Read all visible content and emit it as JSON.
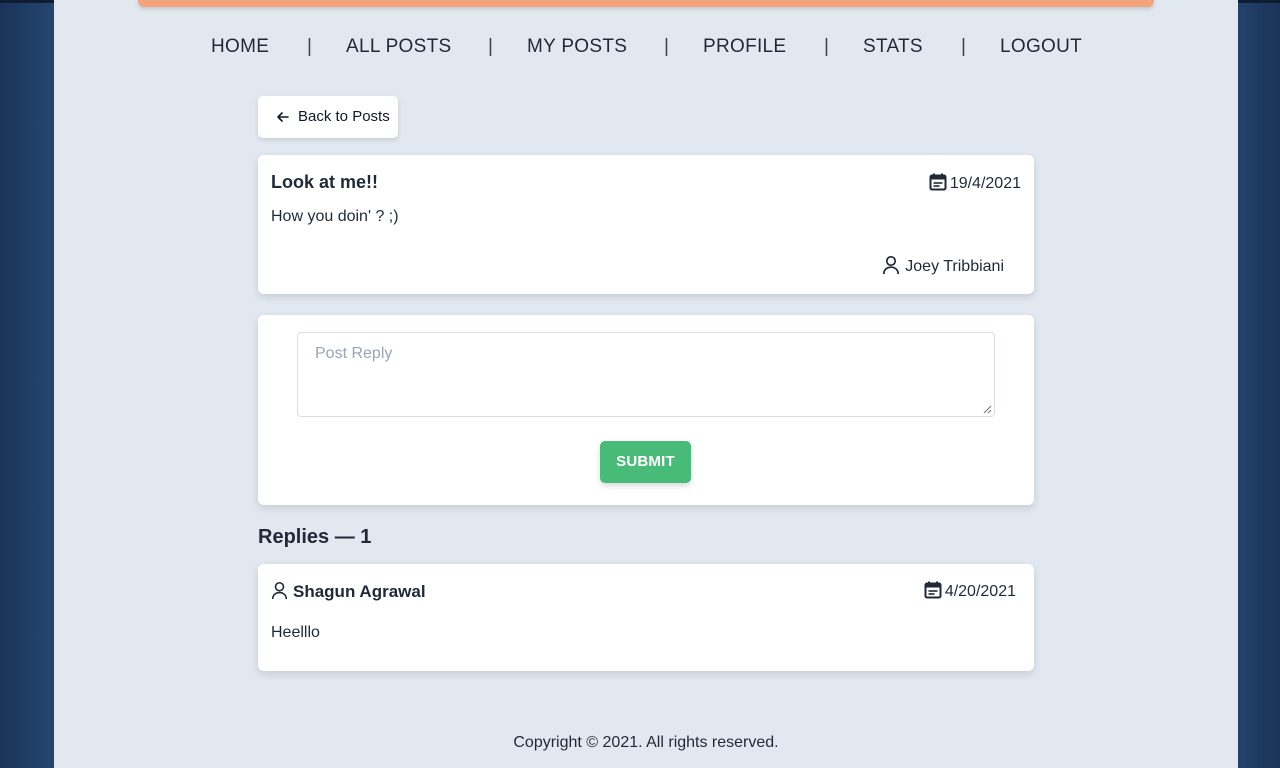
{
  "nav": {
    "items": [
      "HOME",
      "ALL POSTS",
      "MY POSTS",
      "PROFILE",
      "STATS",
      "LOGOUT"
    ],
    "separator": "|"
  },
  "back_button": {
    "label": "Back to Posts",
    "icon": "arrow-left-icon"
  },
  "post": {
    "title": "Look at me!!",
    "date": "19/4/2021",
    "body": "How you doin' ? ;)",
    "author": "Joey Tribbiani"
  },
  "reply_form": {
    "placeholder": "Post Reply",
    "submit_label": "SUBMIT"
  },
  "replies": {
    "heading": "Replies — 1",
    "items": [
      {
        "author": "Shagun Agrawal",
        "date": "4/20/2021",
        "body": "Heelllo"
      }
    ]
  },
  "footer": {
    "text": "Copyright © 2021. All rights reserved."
  },
  "colors": {
    "background": "#25456f",
    "page": "#e2e8f0",
    "accent": "#f4a37c",
    "submit": "#48bb78"
  }
}
